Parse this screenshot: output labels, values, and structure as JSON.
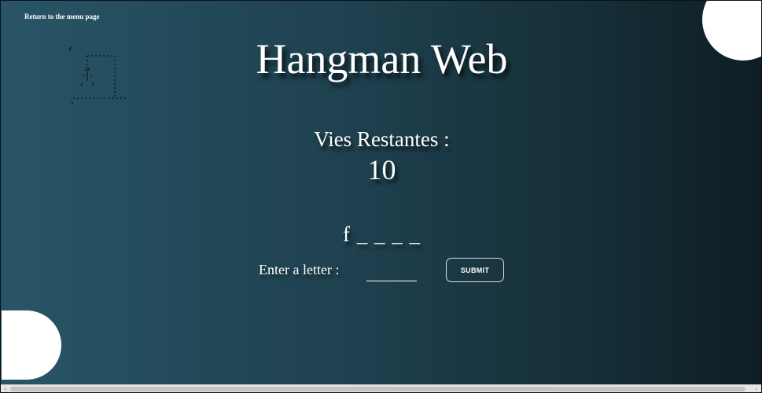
{
  "nav": {
    "return_label": "Return to the menu page"
  },
  "game": {
    "title": "Hangman Web",
    "lives_label": "Vies Restantes :",
    "lives_value": "10",
    "word_display": "f _ _ _ _",
    "input_label": "Enter a letter :",
    "input_value": "",
    "submit_label": "SUBMIT"
  },
  "hangman_ascii": {
    "description_icon": "hangman-drawing-icon"
  },
  "scrollbar": {
    "left_arrow": "‹",
    "right_arrow": "›"
  },
  "colors": {
    "background_left": "#285566",
    "background_right": "#0f1e25",
    "text": "#ffffff",
    "decor_circle": "#ffffff"
  }
}
